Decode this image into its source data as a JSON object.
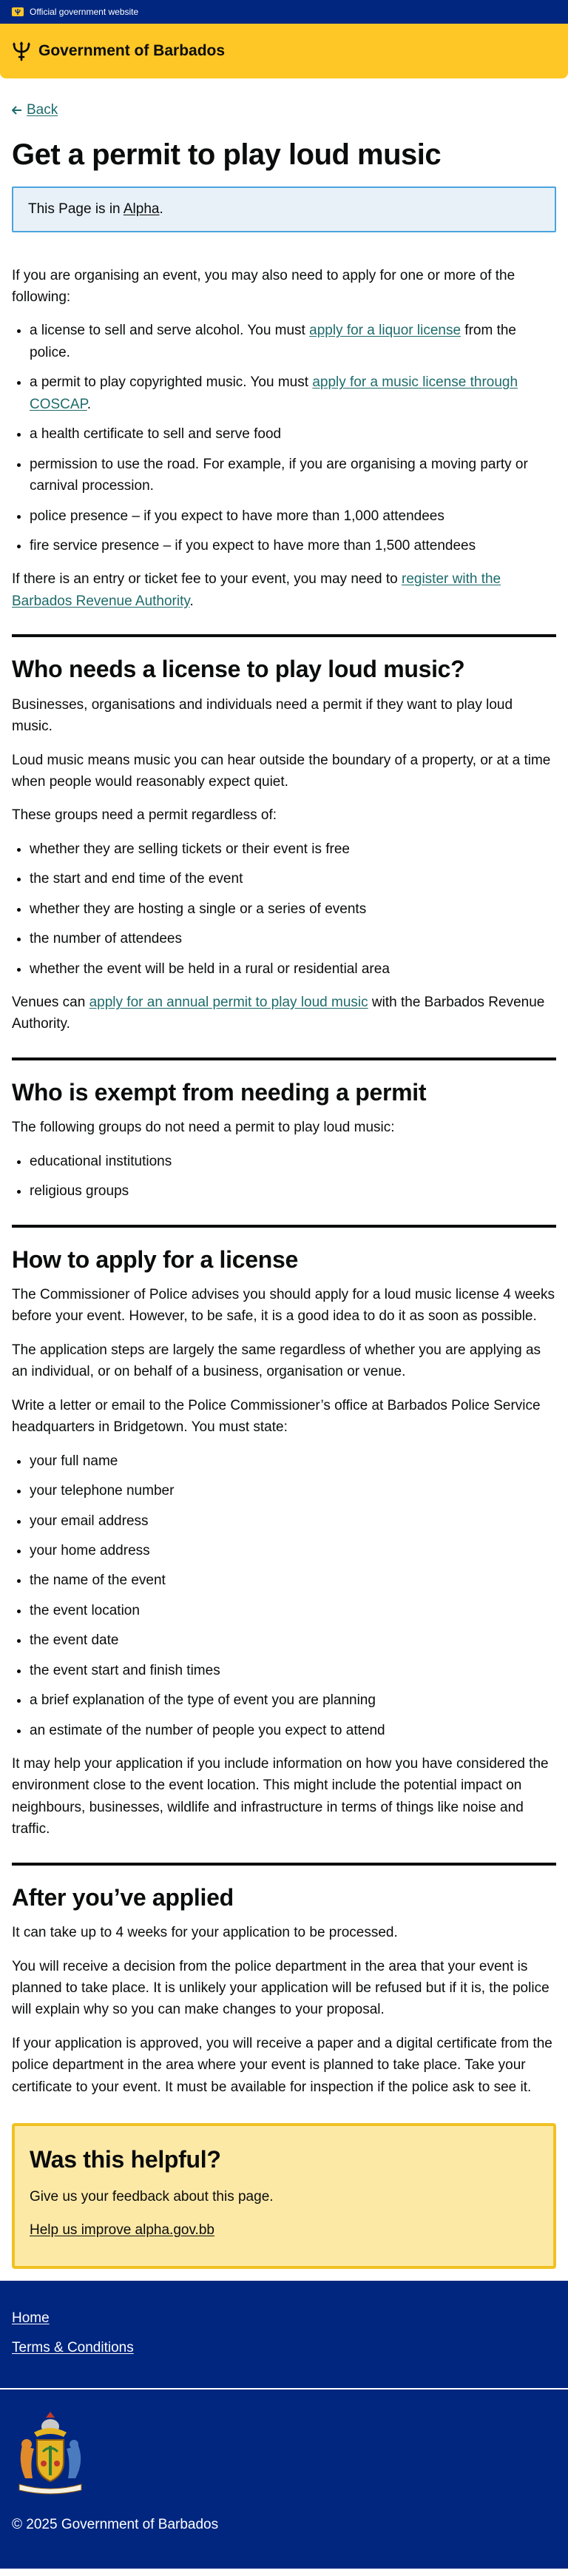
{
  "gov_strip": {
    "text": "Official government website"
  },
  "header": {
    "brand": "Government of Barbados"
  },
  "back": {
    "label": "Back"
  },
  "page": {
    "title": "Get a permit to play loud music",
    "phase_prefix": "This Page is in",
    "phase_link": "Alpha",
    "phase_suffix": "."
  },
  "intro": {
    "lead": "If you are organising an event, you may also need to apply for one or more of the following:",
    "item1_pre": "a license to sell and serve alcohol. You must ",
    "item1_link": "apply for a liquor license",
    "item1_post": " from the police.",
    "item2_pre": "a permit to play copyrighted music. You must ",
    "item2_link": "apply for a music license through COSCAP",
    "item2_post": ".",
    "item3": "a health certificate to sell and serve food",
    "item4": "permission to use the road. For example, if you are organising a moving party or carnival procession.",
    "item5": "police presence – if you expect to have more than 1,000 attendees",
    "item6": "fire service presence –  if you expect to have more than 1,500 attendees",
    "fee_pre": "If there is an entry or ticket fee to your event, you may need to ",
    "fee_link": "register with the Barbados Revenue Authority",
    "fee_post": "."
  },
  "who_needs": {
    "heading": "Who needs a license to play loud music?",
    "p1": "Businesses, organisations and individuals need a permit if they want to play loud music.",
    "p2": "Loud music means music you can hear outside the boundary of a property, or at a time when people would reasonably expect quiet.",
    "p3": "These groups need a permit regardless of:",
    "items": [
      "whether they are selling tickets or their event is free",
      "the start and end time of the event",
      "whether they are hosting a single or a series of events",
      "the number of attendees",
      "whether the event will be held in a rural or residential area"
    ],
    "venues_pre": "Venues can ",
    "venues_link": "apply for an annual permit to play loud music",
    "venues_post": " with the Barbados Revenue Authority."
  },
  "exempt": {
    "heading": "Who is exempt from needing a permit",
    "p1": "The following groups do not need a permit to play loud music:",
    "items": [
      "educational institutions",
      "religious groups"
    ]
  },
  "apply": {
    "heading": "How to apply for a license",
    "p1": "The Commissioner of Police advises you should apply for a loud music license 4 weeks before your event. However, to be safe, it is a good idea to do it as soon as possible.",
    "p2": "The application steps are largely the same regardless of whether you are applying as an individual, or on behalf of a business, organisation or venue.",
    "p3": "Write a letter or email to the Police Commissioner’s office at Barbados Police Service headquarters in Bridgetown. You must state:",
    "items": [
      "your full name",
      "your telephone number",
      "your email address",
      "your home address",
      "the name of the event",
      "the event location",
      "the event date",
      "the event start and finish times",
      "a brief explanation of the type of event you are planning",
      "an estimate of the number of people you expect to attend"
    ],
    "p4": "It may help your application if you include information on how you have considered the environment close to the event location. This might include the potential impact on neighbours, businesses, wildlife and infrastructure in terms of things like noise and traffic."
  },
  "after": {
    "heading": "After you’ve applied",
    "p1": "It can take up to 4 weeks for your application to be processed.",
    "p2": "You will receive a decision from the police department in the area that your event is planned to take place. It is unlikely your application will be refused but if it is, the police will explain why so you can make changes to your proposal.",
    "p3": "If your application is approved, you will receive a paper and a digital certificate from the police department in the area where your event is planned to take place. Take your certificate to your event. It must be available for inspection if the police ask to see it."
  },
  "feedback": {
    "heading": "Was this helpful?",
    "text": "Give us your feedback about this page.",
    "link": "Help us improve alpha.gov.bb"
  },
  "footer": {
    "home": "Home",
    "terms": "Terms & Conditions",
    "copyright": "© 2025 Government of Barbados"
  },
  "colors": {
    "gov_blue": "#00267f",
    "header_yellow": "#ffc726",
    "link_teal": "#1e6b6b",
    "banner_blue": "#e8f1f8",
    "feedback_yellow": "#fde9a6"
  }
}
